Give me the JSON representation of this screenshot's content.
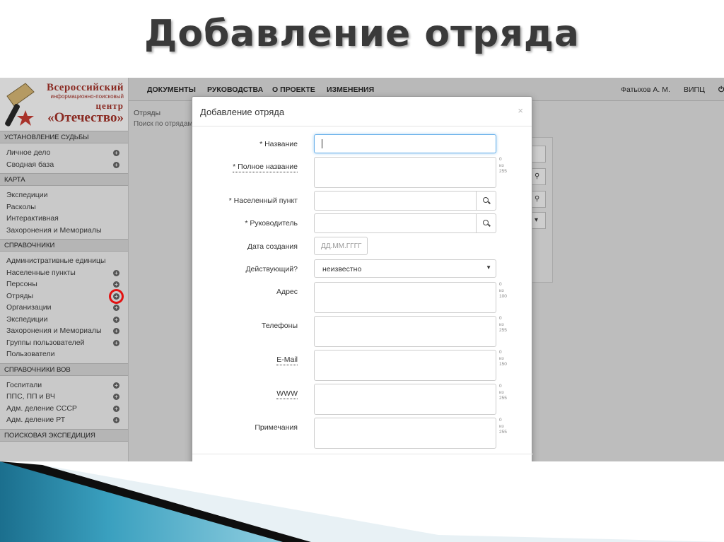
{
  "slide": {
    "title": "Добавление отряда"
  },
  "logo": {
    "line1": "Всероссийский",
    "line2": "информационно-поисковый",
    "line3": "центр",
    "line4": "«Отечество»"
  },
  "sidebar": {
    "sections": [
      {
        "title": "УСТАНОВЛЕНИЕ СУДЬБЫ",
        "items": [
          {
            "label": "Личное дело",
            "plus": true
          },
          {
            "label": "Сводная база",
            "plus": true
          }
        ]
      },
      {
        "title": "КАРТА",
        "items": [
          {
            "label": "Экспедиции",
            "plus": false
          },
          {
            "label": "Расколы",
            "plus": false
          },
          {
            "label": "Интерактивная",
            "plus": false
          },
          {
            "label": "Захоронения и Мемориалы",
            "plus": false
          }
        ]
      },
      {
        "title": "СПРАВОЧНИКИ",
        "items": [
          {
            "label": "Административные единицы",
            "plus": false
          },
          {
            "label": "Населенные пункты",
            "plus": true
          },
          {
            "label": "Персоны",
            "plus": true
          },
          {
            "label": "Отряды",
            "plus": true,
            "highlight": true
          },
          {
            "label": "Организации",
            "plus": true
          },
          {
            "label": "Экспедиции",
            "plus": true
          },
          {
            "label": "Захоронения и Мемориалы",
            "plus": true
          },
          {
            "label": "Группы пользователей",
            "plus": true
          },
          {
            "label": "Пользователи",
            "plus": false
          }
        ]
      },
      {
        "title": "СПРАВОЧНИКИ ВОВ",
        "items": [
          {
            "label": "Госпитали",
            "plus": true
          },
          {
            "label": "ППС, ПП и ВЧ",
            "plus": true
          },
          {
            "label": "Адм. деление СССР",
            "plus": true
          },
          {
            "label": "Адм. деление РТ",
            "plus": true
          }
        ]
      },
      {
        "title": "ПОИСКОВАЯ ЭКСПЕДИЦИЯ",
        "items": []
      }
    ]
  },
  "topnav": {
    "items": [
      "ДОКУМЕНТЫ",
      "РУКОВОДСТВА",
      "О ПРОЕКТЕ",
      "ИЗМЕНЕНИЯ"
    ],
    "user": "Фатыхов А. М.",
    "org": "ВИПЦ"
  },
  "background": {
    "breadcrumb": "Отряды",
    "search_label": "Поиск по отрядам"
  },
  "modal": {
    "title": "Добавление отряда",
    "close": "×",
    "fields": {
      "name": {
        "label": "* Название",
        "value": ""
      },
      "full_name": {
        "label": "* Полное название",
        "counter_value": "0",
        "counter_sep": "из",
        "counter_max": "255"
      },
      "settlement": {
        "label": "* Населенный пункт",
        "value": ""
      },
      "leader": {
        "label": "* Руководитель",
        "value": ""
      },
      "created": {
        "label": "Дата создания",
        "placeholder": "ДД.ММ.ГГГГ"
      },
      "active": {
        "label": "Действующий?",
        "value": "неизвестно"
      },
      "address": {
        "label": "Адрес",
        "counter_value": "0",
        "counter_sep": "из",
        "counter_max": "100"
      },
      "phones": {
        "label": "Телефоны",
        "counter_value": "0",
        "counter_sep": "из",
        "counter_max": "255"
      },
      "email": {
        "label": "E-Mail",
        "counter_value": "0",
        "counter_sep": "из",
        "counter_max": "150"
      },
      "www": {
        "label": "WWW",
        "counter_value": "0",
        "counter_sep": "из",
        "counter_max": "255"
      },
      "notes": {
        "label": "Примечания",
        "counter_value": "0",
        "counter_sep": "из",
        "counter_max": "255"
      }
    }
  },
  "colors": {
    "highlight": "#e31212",
    "focus": "#66afe9",
    "logo": "#8a2a22"
  },
  "icons": [
    "search-icon",
    "plus-circle-icon",
    "close-icon",
    "caret-down-icon"
  ]
}
